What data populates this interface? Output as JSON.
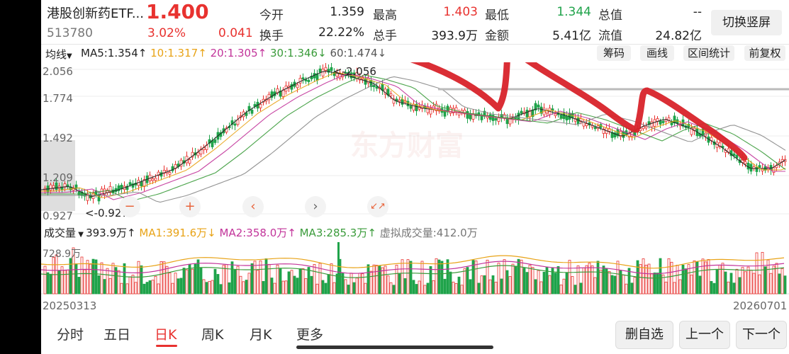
{
  "header": {
    "name": "港股创新药ETF...",
    "code": "513780",
    "price": "1.400",
    "change_pct": "3.02%",
    "change_abs": "0.041",
    "switch_label": "切换竖屏",
    "stats": [
      {
        "label": "今开",
        "value": "1.359",
        "color": "dark"
      },
      {
        "label": "最高",
        "value": "1.403",
        "color": "red"
      },
      {
        "label": "最低",
        "value": "1.344",
        "color": "green"
      },
      {
        "label": "总值",
        "value": "--",
        "color": "dark"
      },
      {
        "label": "换手",
        "value": "22.22%",
        "color": "dark"
      },
      {
        "label": "总手",
        "value": "393.9万",
        "color": "dark"
      },
      {
        "label": "金额",
        "value": "5.41亿",
        "color": "dark"
      },
      {
        "label": "流值",
        "value": "24.82亿",
        "color": "dark"
      }
    ]
  },
  "ma_bar": {
    "selector": "均线",
    "ma5": "MA5:1.354",
    "ma10": "10:1.317",
    "ma20": "20:1.305",
    "ma30": "30:1.346",
    "ma60": "60:1.474",
    "arrows": [
      "↑",
      "↑",
      "↑",
      "↓",
      "↓"
    ],
    "buttons": [
      "筹码",
      "画线",
      "区间统计",
      "前复权"
    ]
  },
  "price_axis": [
    "2.056",
    "1.774",
    "1.492",
    "1.209",
    "0.927"
  ],
  "high_marker": "<-2.056",
  "low_marker": "<-0.927",
  "watermark": "东方财富",
  "zoom_controls": [
    "−",
    "+",
    "‹",
    "›",
    "↙↗"
  ],
  "volume_bar": {
    "selector": "成交量",
    "value": "393.9万",
    "ma1": "MA1:391.6万",
    "ma2": "MA2:358.0万",
    "ma3": "MA3:285.3万",
    "arrows": [
      "↑",
      "↓",
      "↑",
      "↑"
    ],
    "virtual": "虚拟成交量:412.0万",
    "axis_max": "728.9万"
  },
  "dates": {
    "start": "20250313",
    "end": "20260701"
  },
  "bottom_tabs": [
    "分时",
    "五日",
    "日K",
    "周K",
    "月K",
    "更多"
  ],
  "active_tab": "日K",
  "bottom_buttons": [
    "删自选",
    "上一个",
    "下一个"
  ],
  "colors": {
    "up": "#e8322f",
    "down": "#1fa34a",
    "ma5": "#222222",
    "ma10": "#e8a317",
    "ma20": "#c2349a",
    "ma30": "#3a9b3a",
    "ma60": "#888888",
    "annotation": "#d8232a"
  }
}
